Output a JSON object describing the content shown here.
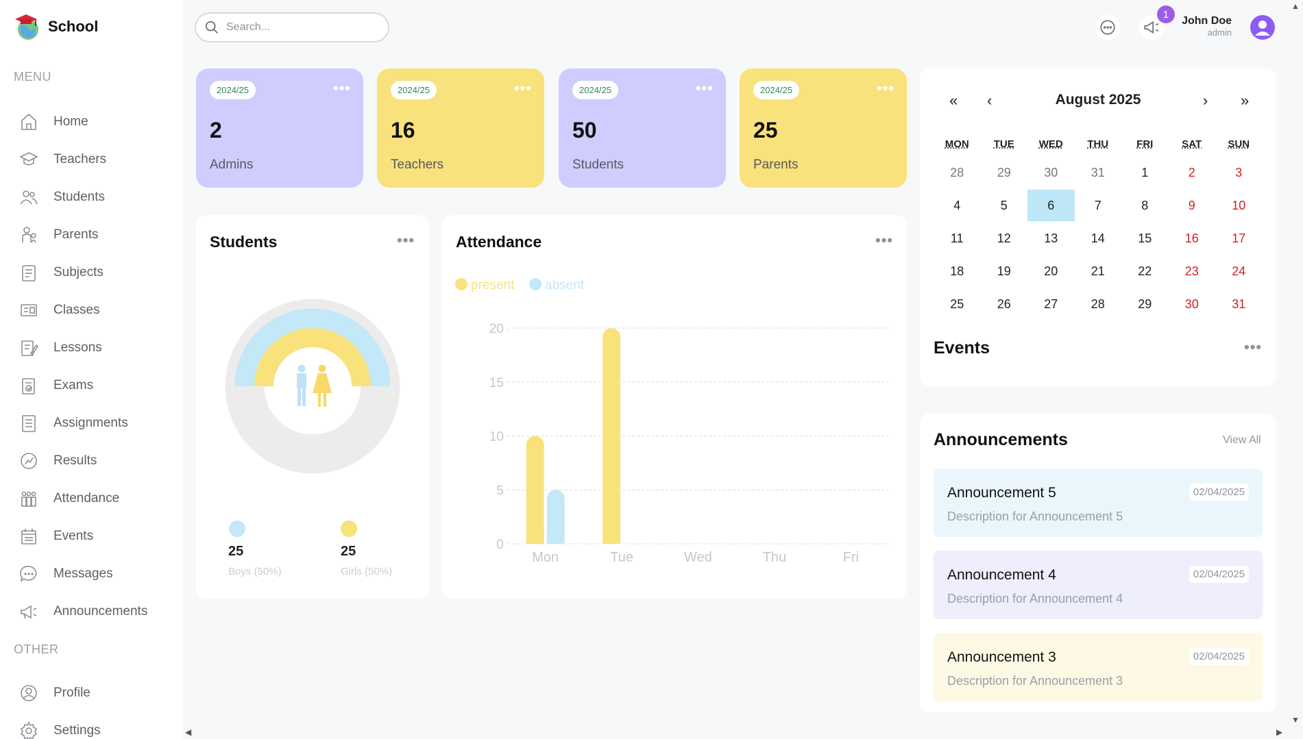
{
  "app": {
    "name": "School"
  },
  "menu_heading": "MENU",
  "other_heading": "OTHER",
  "menu": [
    {
      "label": "Home",
      "icon": "home-icon"
    },
    {
      "label": "Teachers",
      "icon": "teacher-icon"
    },
    {
      "label": "Students",
      "icon": "students-icon"
    },
    {
      "label": "Parents",
      "icon": "parents-icon"
    },
    {
      "label": "Subjects",
      "icon": "subject-icon"
    },
    {
      "label": "Classes",
      "icon": "class-icon"
    },
    {
      "label": "Lessons",
      "icon": "lesson-icon"
    },
    {
      "label": "Exams",
      "icon": "exam-icon"
    },
    {
      "label": "Assignments",
      "icon": "assignment-icon"
    },
    {
      "label": "Results",
      "icon": "result-icon"
    },
    {
      "label": "Attendance",
      "icon": "attendance-icon"
    },
    {
      "label": "Events",
      "icon": "calendar-icon"
    },
    {
      "label": "Messages",
      "icon": "message-icon"
    },
    {
      "label": "Announcements",
      "icon": "megaphone-icon"
    }
  ],
  "other": [
    {
      "label": "Profile",
      "icon": "profile-icon"
    },
    {
      "label": "Settings",
      "icon": "settings-icon"
    }
  ],
  "search": {
    "placeholder": "Search..."
  },
  "user": {
    "name": "John Doe",
    "role": "admin",
    "notification_count": "1"
  },
  "stats": [
    {
      "year": "2024/25",
      "value": "2",
      "label": "Admins",
      "color": "#cfcdfd"
    },
    {
      "year": "2024/25",
      "value": "16",
      "label": "Teachers",
      "color": "#f9e27c"
    },
    {
      "year": "2024/25",
      "value": "50",
      "label": "Students",
      "color": "#cfcdfd"
    },
    {
      "year": "2024/25",
      "value": "25",
      "label": "Parents",
      "color": "#f9e27c"
    }
  ],
  "students_chart": {
    "title": "Students",
    "boys": {
      "count": "25",
      "label": "Boys (50%)",
      "color": "#c3e8f8"
    },
    "girls": {
      "count": "25",
      "label": "Girls (50%)",
      "color": "#f9e27c"
    }
  },
  "attendance": {
    "title": "Attendance",
    "legend": [
      {
        "label": "present",
        "color": "#f9e27c"
      },
      {
        "label": "absent",
        "color": "#c3e8f8"
      }
    ]
  },
  "chart_data": {
    "type": "bar",
    "categories": [
      "Mon",
      "Tue",
      "Wed",
      "Thu",
      "Fri"
    ],
    "series": [
      {
        "name": "present",
        "values": [
          10,
          20,
          0,
          0,
          0
        ],
        "color": "#f9e27c"
      },
      {
        "name": "absent",
        "values": [
          5,
          0,
          0,
          0,
          0
        ],
        "color": "#c3e8f8"
      }
    ],
    "yticks": [
      0,
      5,
      10,
      15,
      20
    ],
    "ylim": [
      0,
      20
    ],
    "grid": true,
    "legend": "top-left"
  },
  "calendar": {
    "title": "August 2025",
    "nav": {
      "first": "«",
      "prev": "‹",
      "next": "›",
      "last": "»"
    },
    "weekdays": [
      "MON",
      "TUE",
      "WED",
      "THU",
      "FRI",
      "SAT",
      "SUN"
    ],
    "weeks": [
      [
        "28",
        "29",
        "30",
        "31",
        "1",
        "2",
        "3"
      ],
      [
        "4",
        "5",
        "6",
        "7",
        "8",
        "9",
        "10"
      ],
      [
        "11",
        "12",
        "13",
        "14",
        "15",
        "16",
        "17"
      ],
      [
        "18",
        "19",
        "20",
        "21",
        "22",
        "23",
        "24"
      ],
      [
        "25",
        "26",
        "27",
        "28",
        "29",
        "30",
        "31"
      ]
    ],
    "today": "6"
  },
  "events": {
    "title": "Events"
  },
  "announcements": {
    "title": "Announcements",
    "view_all": "View All",
    "items": [
      {
        "title": "Announcement 5",
        "date": "02/04/2025",
        "description": "Description for Announcement 5"
      },
      {
        "title": "Announcement 4",
        "date": "02/04/2025",
        "description": "Description for Announcement 4"
      },
      {
        "title": "Announcement 3",
        "date": "02/04/2025",
        "description": "Description for Announcement 3"
      }
    ]
  },
  "dots": "•••"
}
